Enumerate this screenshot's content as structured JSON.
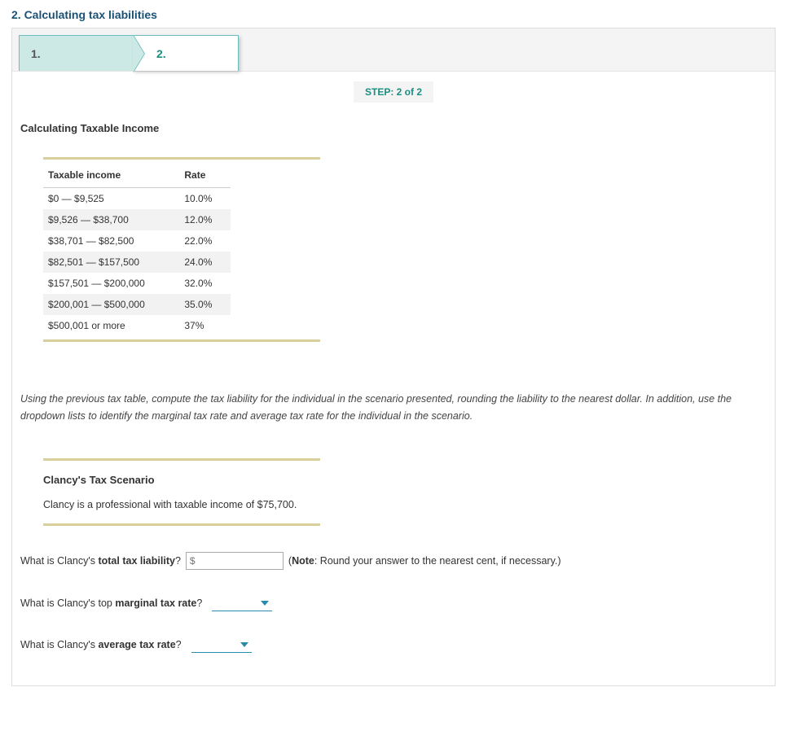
{
  "title": "2. Calculating tax liabilities",
  "tabs": {
    "first": "1.",
    "second": "2."
  },
  "step": {
    "label": "STEP:",
    "value": "2 of 2"
  },
  "heading": "Calculating Taxable Income",
  "table": {
    "header_income": "Taxable income",
    "header_rate": "Rate",
    "rows": [
      {
        "range": "$0 — $9,525",
        "rate": "10.0%"
      },
      {
        "range": "$9,526 — $38,700",
        "rate": "12.0%"
      },
      {
        "range": "$38,701 — $82,500",
        "rate": "22.0%"
      },
      {
        "range": "$82,501 — $157,500",
        "rate": "24.0%"
      },
      {
        "range": "$157,501 — $200,000",
        "rate": "32.0%"
      },
      {
        "range": "$200,001 — $500,000",
        "rate": "35.0%"
      },
      {
        "range": "$500,001 or more",
        "rate": "37%"
      }
    ]
  },
  "instructions": "Using the previous tax table, compute the tax liability for the individual in the scenario presented, rounding the liability to the nearest dollar. In addition, use the dropdown lists to identify the marginal tax rate and average tax rate for the individual in the scenario.",
  "scenario": {
    "heading": "Clancy's Tax Scenario",
    "text": "Clancy is a professional with taxable income of $75,700."
  },
  "q1": {
    "pre": "What is Clancy's ",
    "bold": "total tax liability",
    "post": "?",
    "placeholder": "$",
    "note_pre": "(",
    "note_bold": "Note",
    "note_post": ": Round your answer to the nearest cent, if necessary.)"
  },
  "q2": {
    "pre": "What is Clancy's top ",
    "bold": "marginal tax rate",
    "post": "?"
  },
  "q3": {
    "pre": "What is Clancy's ",
    "bold": "average tax rate",
    "post": "?"
  }
}
